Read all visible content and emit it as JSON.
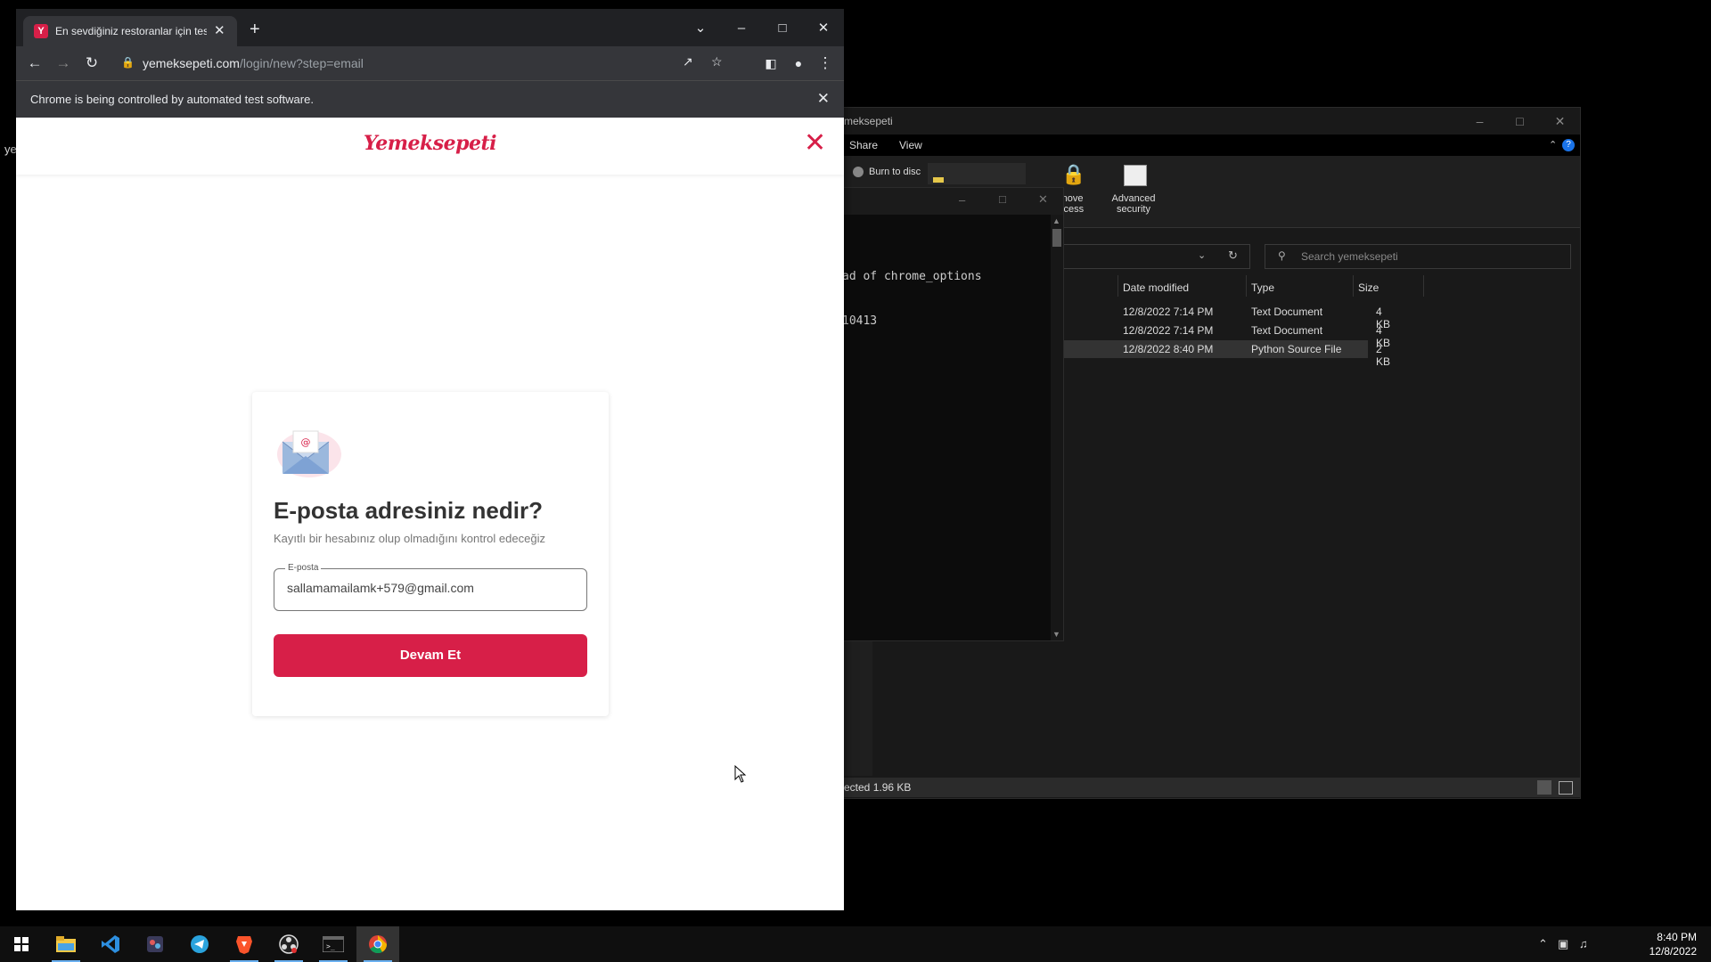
{
  "desktop": {
    "partial_text": "ye"
  },
  "explorer": {
    "title": "meksepeti",
    "menu": [
      "Share",
      "View"
    ],
    "ribbon": {
      "burn_to_disc": "Burn to disc",
      "remove_access": "emove\naccess",
      "advanced_security": "Advanced\nsecurity"
    },
    "search_placeholder": "Search yemeksepeti",
    "columns": {
      "date": "Date modified",
      "type": "Type",
      "size": "Size"
    },
    "files": [
      {
        "date": "12/8/2022 7:14 PM",
        "type": "Text Document",
        "size": "4 KB",
        "selected": false
      },
      {
        "date": "12/8/2022 7:14 PM",
        "type": "Text Document",
        "size": "4 KB",
        "selected": false
      },
      {
        "date": "12/8/2022 8:40 PM",
        "type": "Python Source File",
        "size": "2 KB",
        "selected": true
      }
    ],
    "status": "ected  1.96 KB"
  },
  "terminal": {
    "lines": [
      "ad of chrome_options",
      "10413"
    ]
  },
  "chrome": {
    "tab_title": "En sevdiğiniz restoranlar için tesl",
    "favicon_letter": "Y",
    "url_host": "yemeksepeti.com",
    "url_path": "/login/new?step=email",
    "infobar": "Chrome is being controlled by automated test software."
  },
  "page": {
    "logo": "Yemeksepeti",
    "heading": "E-posta adresiniz nedir?",
    "subtext": "Kayıtlı bir hesabınız olup olmadığını kontrol edeceğiz",
    "email_label": "E-posta",
    "email_value": "sallamamailamk+579@gmail.com",
    "continue_label": "Devam Et"
  },
  "taskbar": {
    "time": "8:40 PM",
    "date": "12/8/2022",
    "apps": [
      "start-icon",
      "file-explorer-icon",
      "vscode-icon",
      "media-app-icon",
      "telegram-icon",
      "brave-icon",
      "obs-icon",
      "terminal-icon",
      "chrome-icon"
    ]
  },
  "colors": {
    "brand": "#d71f48",
    "chrome_dark": "#35363a",
    "explorer_bg": "#191919"
  }
}
